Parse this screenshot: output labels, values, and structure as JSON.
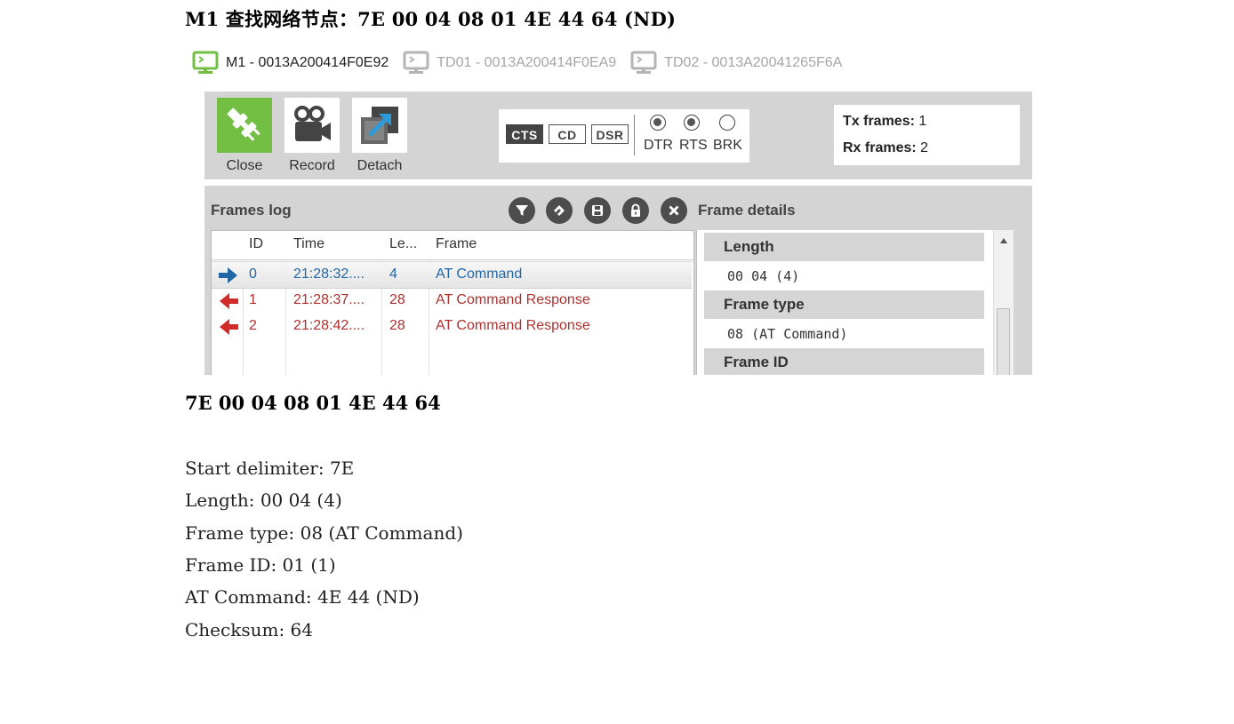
{
  "heading": "M1 查找网络节点：7E 00 04 08 01 4E 44 64 (ND)",
  "device_tabs": [
    {
      "label": "M1 - 0013A200414F0E92",
      "active": true
    },
    {
      "label": "TD01 - 0013A200414F0EA9",
      "active": false
    },
    {
      "label": "TD02 - 0013A20041265F6A",
      "active": false
    }
  ],
  "toolbar": {
    "close_label": "Close",
    "record_label": "Record",
    "detach_label": "Detach"
  },
  "lines": {
    "cts": "CTS",
    "cd": "CD",
    "dsr": "DSR",
    "dtr": "DTR",
    "rts": "RTS",
    "brk": "BRK"
  },
  "counters": {
    "tx_label": "Tx frames:",
    "tx_value": "1",
    "rx_label": "Rx frames:",
    "rx_value": "2"
  },
  "frames_log": {
    "title": "Frames log",
    "columns": {
      "id": "ID",
      "time": "Time",
      "length": "Le...",
      "frame": "Frame"
    },
    "rows": [
      {
        "id": "0",
        "time": "21:28:32....",
        "length": "4",
        "frame": "AT Command",
        "direction": "out"
      },
      {
        "id": "1",
        "time": "21:28:37....",
        "length": "28",
        "frame": "AT Command Response",
        "direction": "in"
      },
      {
        "id": "2",
        "time": "21:28:42....",
        "length": "28",
        "frame": "AT Command Response",
        "direction": "in"
      }
    ]
  },
  "frame_details": {
    "title": "Frame details",
    "length_label": "Length",
    "length_value": "00 04 (4)",
    "type_label": "Frame type",
    "type_value": "08 (AT Command)",
    "id_label": "Frame ID"
  },
  "document": {
    "hex": "7E 00 04 08 01 4E 44 64",
    "lines": [
      "Start delimiter: 7E",
      "Length: 00 04 (4)",
      "Frame type: 08 (AT Command)",
      "Frame ID: 01 (1)",
      "AT Command: 4E 44 (ND)",
      "Checksum: 64"
    ]
  },
  "colors": {
    "panel_bg": "#d4d4d4",
    "close_green": "#72bf44",
    "outgoing_blue": "#2166a5",
    "incoming_red": "#b03030",
    "active_monitor": "#72bf44"
  }
}
